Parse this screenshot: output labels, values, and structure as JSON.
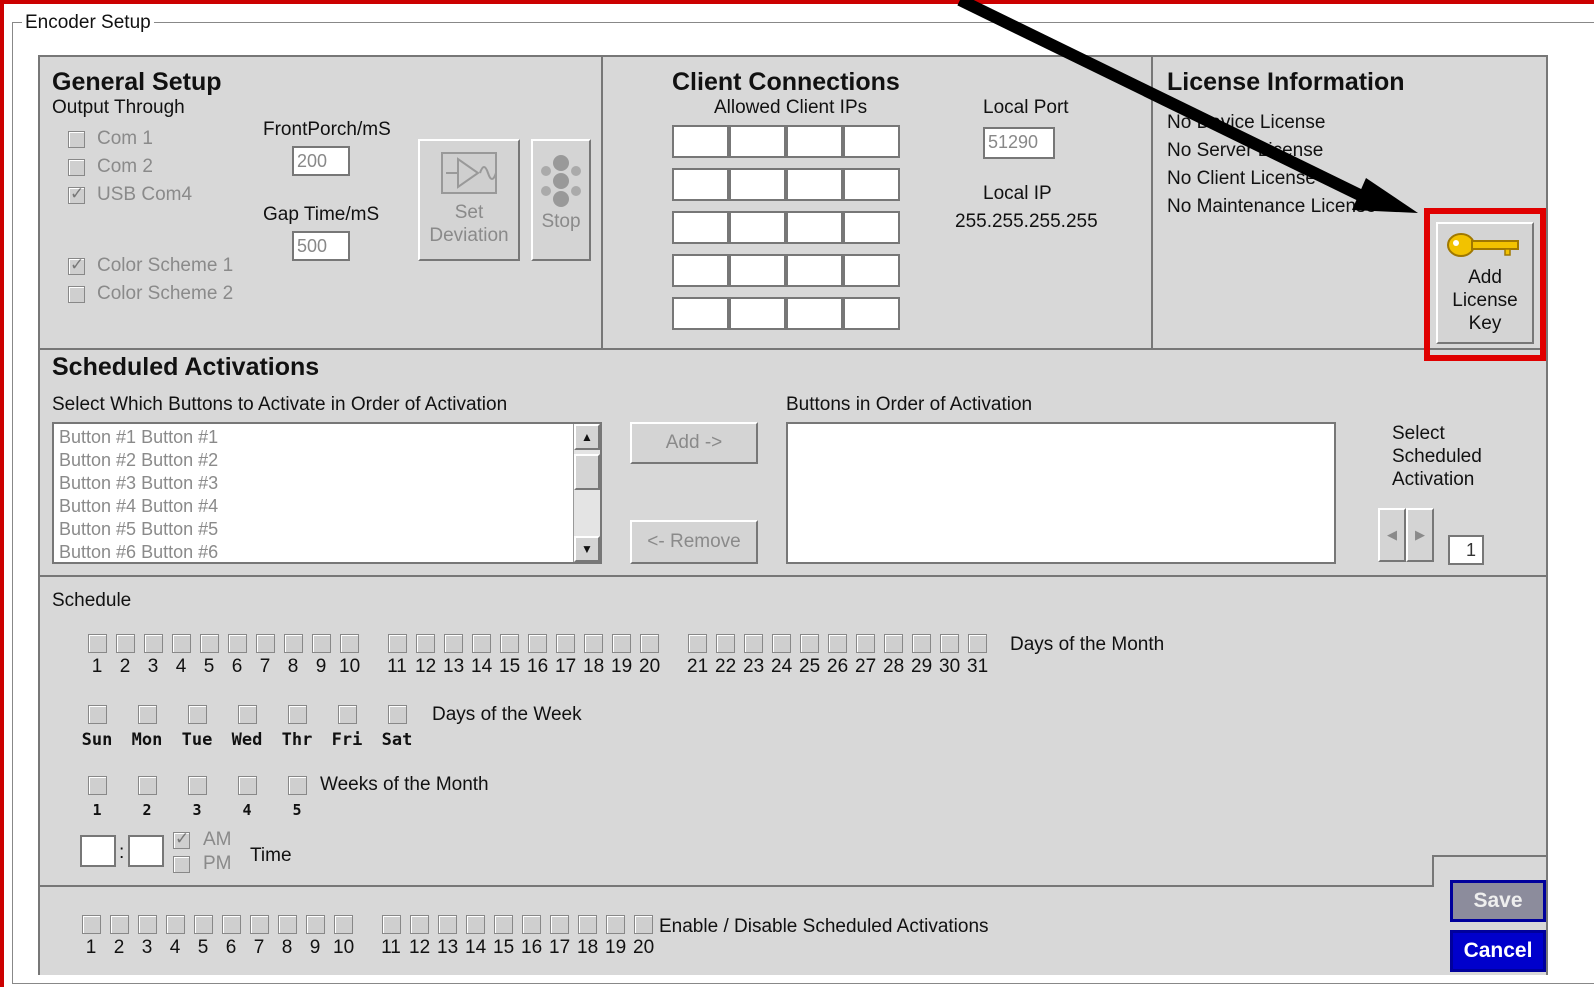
{
  "window": {
    "group_title": "Encoder Setup"
  },
  "general_setup": {
    "title": "General Setup",
    "output_label": "Output Through",
    "outputs": [
      {
        "label": "Com 1",
        "checked": false
      },
      {
        "label": "Com 2",
        "checked": false
      },
      {
        "label": "USB Com4",
        "checked": true
      }
    ],
    "color_schemes": [
      {
        "label": "Color Scheme 1",
        "checked": true
      },
      {
        "label": "Color Scheme 2",
        "checked": false
      }
    ],
    "front_porch_label": "FrontPorch/mS",
    "front_porch_value": "200",
    "gap_time_label": "Gap Time/mS",
    "gap_time_value": "500",
    "set_deviation_label": "Set Deviation",
    "stop_label": "Stop"
  },
  "client_connections": {
    "title": "Client Connections",
    "allowed_label": "Allowed Client IPs",
    "local_port_label": "Local Port",
    "local_port_value": "51290",
    "local_ip_label": "Local IP",
    "local_ip_value": "255.255.255.255"
  },
  "license_info": {
    "title": "License Information",
    "lines": [
      "No Device License",
      "No Server License",
      "No Client License",
      "No Maintenance License"
    ],
    "add_key_label": "Add License Key"
  },
  "scheduled_activations": {
    "title": "Scheduled Activations",
    "select_label": "Select Which Buttons to Activate in Order of Activation",
    "order_label": "Buttons in Order of Activation",
    "buttons": [
      "Button #1 Button #1",
      "Button #2 Button #2",
      "Button #3 Button #3",
      "Button #4 Button #4",
      "Button #5 Button #5",
      "Button #6 Button #6"
    ],
    "add_label": "Add ->",
    "remove_label": "<- Remove",
    "select_scheduled_label": "Select Scheduled Activation",
    "select_scheduled_value": "1"
  },
  "schedule": {
    "title": "Schedule",
    "days_of_month_label": "Days of the Month",
    "days": [
      "1",
      "2",
      "3",
      "4",
      "5",
      "6",
      "7",
      "8",
      "9",
      "10",
      "11",
      "12",
      "13",
      "14",
      "15",
      "16",
      "17",
      "18",
      "19",
      "20",
      "21",
      "22",
      "23",
      "24",
      "25",
      "26",
      "27",
      "28",
      "29",
      "30",
      "31"
    ],
    "days_of_week_label": "Days of the Week",
    "weekdays": [
      "Sun",
      "Mon",
      "Tue",
      "Wed",
      "Thr",
      "Fri",
      "Sat"
    ],
    "weeks_of_month_label": "Weeks of the Month",
    "weeks": [
      "1",
      "2",
      "3",
      "4",
      "5"
    ],
    "time_label": "Time",
    "am_label": "AM",
    "pm_label": "PM",
    "time_separator": ":"
  },
  "enable_disable": {
    "label": "Enable / Disable Scheduled Activations",
    "numbers": [
      "1",
      "2",
      "3",
      "4",
      "5",
      "6",
      "7",
      "8",
      "9",
      "10",
      "11",
      "12",
      "13",
      "14",
      "15",
      "16",
      "17",
      "18",
      "19",
      "20"
    ]
  },
  "actions": {
    "save_label": "Save",
    "cancel_label": "Cancel"
  },
  "colors": {
    "annotation_red": "#e00000",
    "cancel_blue": "#0000cc",
    "panel_gray": "#d8d8d8"
  }
}
